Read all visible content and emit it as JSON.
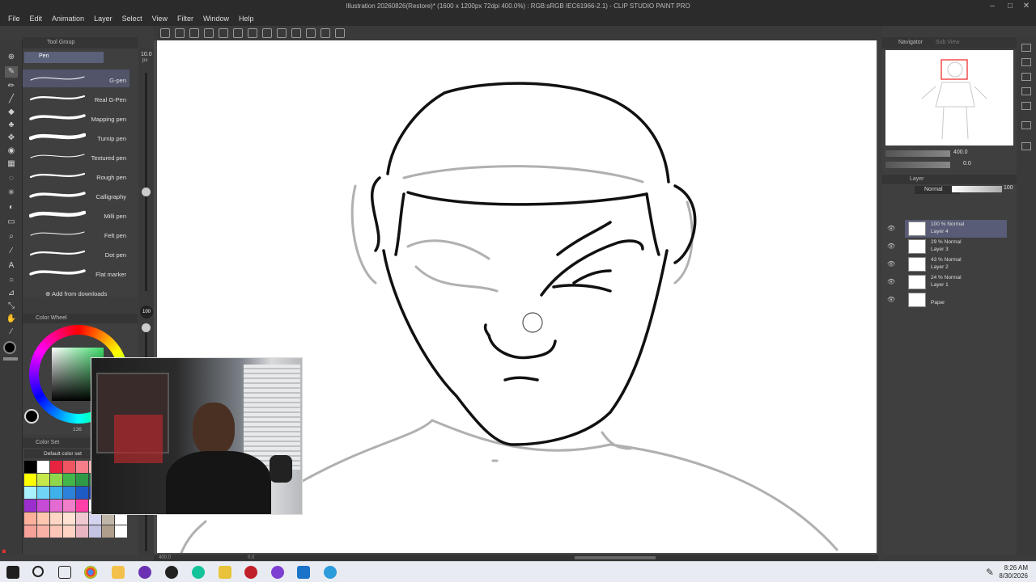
{
  "window": {
    "title": "Illustration 20260826(Restore)* (1600 x 1200px 72dpi 400.0%) : RGB:sRGB IEC61966-2.1) - CLIP STUDIO PAINT PRO"
  },
  "menu": [
    "File",
    "Edit",
    "Animation",
    "Layer",
    "Select",
    "View",
    "Filter",
    "Window",
    "Help"
  ],
  "subtool": {
    "header": "Tool Group",
    "group": "Pen",
    "brushes": [
      {
        "label": "G-pen",
        "active": true
      },
      {
        "label": "Real G-Pen",
        "active": false
      },
      {
        "label": "Mapping pen",
        "active": false
      },
      {
        "label": "Turnip pen",
        "active": false
      },
      {
        "label": "Textured pen",
        "active": false
      },
      {
        "label": "Rough pen",
        "active": false
      },
      {
        "label": "Calligraphy",
        "active": false
      },
      {
        "label": "Milli pen",
        "active": false
      },
      {
        "label": "Felt pen",
        "active": false
      },
      {
        "label": "Dot pen",
        "active": false
      },
      {
        "label": "Flat marker",
        "active": false
      }
    ],
    "add_from_downloads": "Add from downloads"
  },
  "size": {
    "brush_size": "10.0",
    "unit": "px",
    "opacity": "100"
  },
  "color_wheel": {
    "title": "Color Wheel",
    "value_readout": "136"
  },
  "color_set": {
    "title": "Color Set",
    "set_name": "Default color set",
    "swatches": [
      "#000000",
      "#ffffff",
      "#e8233f",
      "#f05562",
      "#f57e8a",
      "#ffaaaa",
      "#ffffff",
      "#ffffff",
      "#ffff00",
      "#c6e84a",
      "#8fd64c",
      "#43b649",
      "#2e9a48",
      "#1d6e3a",
      "#ffffff",
      "#ffffff",
      "#aaf1ff",
      "#6fd4f5",
      "#3fb0e9",
      "#2c82d9",
      "#1f5bc7",
      "#1a3a9e",
      "#ffffff",
      "#ffffff",
      "#9b2ecf",
      "#c64bd6",
      "#e36bd1",
      "#f07ec8",
      "#ff3ea8",
      "#ffffff",
      "#ffffff",
      "#ffffff",
      "#ffb09b",
      "#ffc6b0",
      "#ffd6c6",
      "#ffe2d4",
      "#f0c8d2",
      "#d5d4f0",
      "#c0b6a8",
      "#ffffff",
      "#f7a198",
      "#f9b3a6",
      "#fcc5b7",
      "#fdd3c4",
      "#e8b5c0",
      "#c5c3e3",
      "#b09e8c",
      "#ffffff"
    ]
  },
  "navigator": {
    "title": "Navigator",
    "tab2": "Sub View",
    "zoom": "400.0",
    "rotation": "0.0"
  },
  "layers": {
    "title": "Layer",
    "blend_mode": "Normal",
    "opacity": "100",
    "items": [
      {
        "line1": "100 % Normal",
        "line2": "Layer 4",
        "active": true
      },
      {
        "line1": "29 % Normal",
        "line2": "Layer 3",
        "active": false
      },
      {
        "line1": "43 % Normal",
        "line2": "Layer 2",
        "active": false
      },
      {
        "line1": "24 % Normal",
        "line2": "Layer 1",
        "active": false
      },
      {
        "line1": "",
        "line2": "Paper",
        "active": false
      }
    ]
  },
  "status": {
    "zoom": "400.0",
    "angle": "0.0"
  },
  "taskbar": {
    "time": "8:26 AM",
    "date": "8/30/2026"
  }
}
